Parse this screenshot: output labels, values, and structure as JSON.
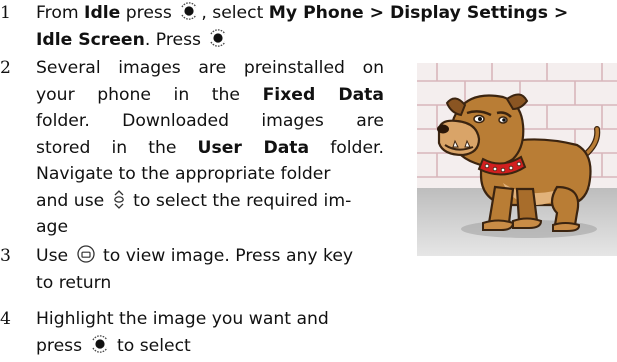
{
  "steps": [
    {
      "number": "1",
      "lines": [
        [
          "From ",
          "Idle",
          " press ",
          "{center-key}",
          ", select ",
          "My Phone > Display Settings >"
        ],
        [
          "Idle Screen",
          ". Press ",
          "{center-key}"
        ]
      ]
    },
    {
      "number": "2",
      "lines": [
        [
          "Several images are preinstalled on"
        ],
        [
          "your phone in the ",
          "Fixed Data"
        ],
        [
          "folder. Downloaded images are"
        ],
        [
          "stored in the ",
          "User Data",
          " folder."
        ],
        [
          "Navigate to the appropriate folder"
        ],
        [
          "and use ",
          "{nav-key}",
          " to select the required im-"
        ],
        [
          "age"
        ]
      ]
    },
    {
      "number": "3",
      "lines": [
        [
          "Use ",
          "{view-key}",
          " to view image. Press any key"
        ],
        [
          "to return"
        ]
      ]
    },
    {
      "number": "4",
      "lines": [
        [
          "Highlight the image you want and"
        ],
        [
          "press ",
          "{center-key}",
          " to select"
        ]
      ]
    }
  ],
  "text": {
    "s1_from": "From ",
    "s1_idle": "Idle",
    "s1_press": " press ",
    "s1_select": ", select ",
    "s1_path": "My Phone > Display Settings >",
    "s1_idle_screen": "Idle Screen",
    "s1_press2": ". Press",
    "s2_l1": "Several images are preinstalled on",
    "s2_l2a": "your phone in the ",
    "s2_l2b": "Fixed Data",
    "s2_l3": "folder. Downloaded images are",
    "s2_l4a": "stored in the ",
    "s2_l4b": "User Data",
    "s2_l4c": " folder.",
    "s2_l5": "Navigate to the appropriate folder",
    "s2_l6a": "and use ",
    "s2_l6b": " to select the required im-",
    "s2_l7": "age",
    "s3_l1a": "Use ",
    "s3_l1b": " to view image. Press any key",
    "s3_l2": "to return",
    "s4_l1": "Highlight the image you want and",
    "s4_l2a": "press ",
    "s4_l2b": " to select",
    "n1": "1",
    "n2": "2",
    "n3": "3",
    "n4": "4"
  },
  "icons": {
    "center_key": "center-select-key-icon",
    "nav_key": "up-down-navigation-key-icon",
    "view_key": "view-softkey-icon"
  },
  "illustration": {
    "subject": "cartoon bulldog with spiked red collar in front of brick wall",
    "colors": {
      "wall": "#f3ecec",
      "brick_line": "#d9b8bc",
      "floor": "#d0d0d0",
      "dog": "#b97d35",
      "dog_light": "#e0b57a",
      "collar": "#d11f1f"
    }
  }
}
